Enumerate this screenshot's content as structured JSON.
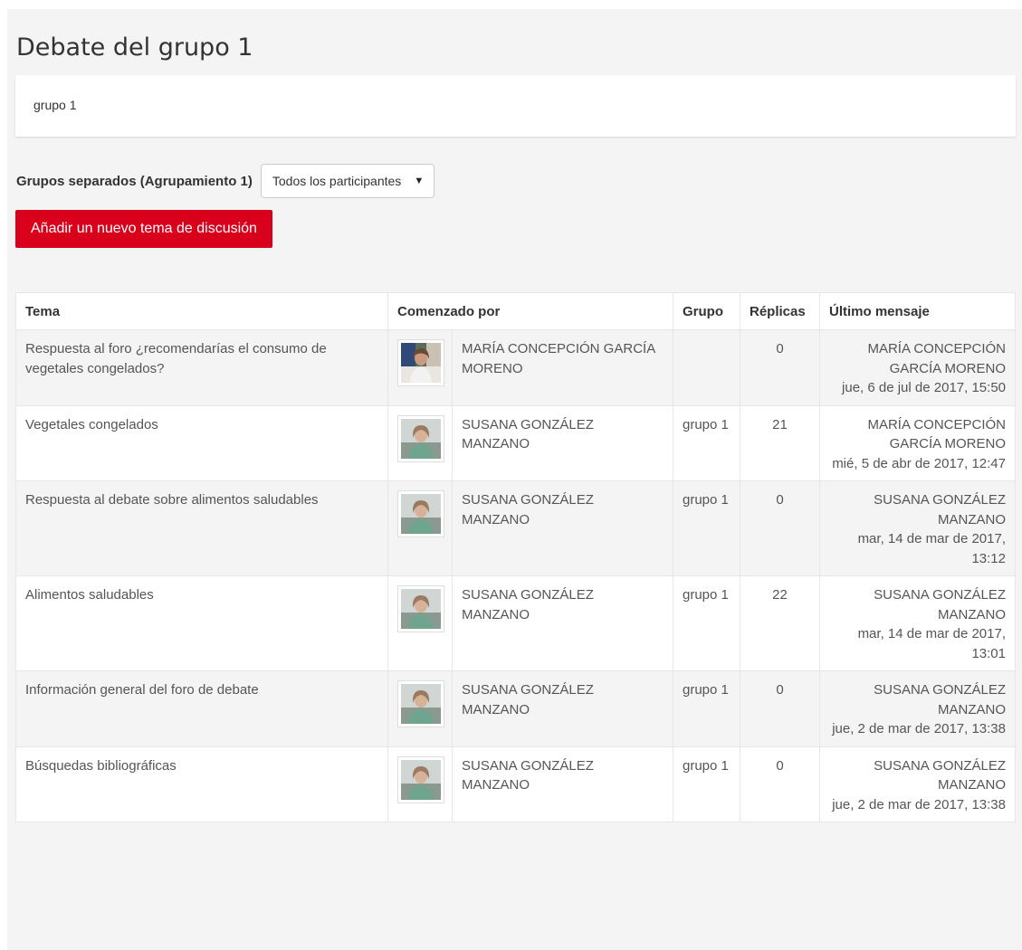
{
  "page_title": "Debate del grupo 1",
  "intro_text": "grupo 1",
  "groups": {
    "label": "Grupos separados (Agrupamiento 1)",
    "selected": "Todos los participantes"
  },
  "add_button_label": "Añadir un nuevo tema de discusión",
  "table": {
    "headers": [
      "Tema",
      "Comenzado por",
      "Grupo",
      "Réplicas",
      "Último mensaje"
    ],
    "rows": [
      {
        "topic": "Respuesta al foro ¿recomendarías el consumo de vegetales congelados?",
        "avatar": "woman-photo-indoor",
        "started_by": "MARÍA CONCEPCIÓN GARCÍA MORENO",
        "group": "",
        "replies": "0",
        "last_user": "MARÍA CONCEPCIÓN GARCÍA MORENO",
        "last_date": "jue, 6 de jul de 2017, 15:50"
      },
      {
        "topic": "Vegetales congelados",
        "avatar": "woman-photo-outdoor",
        "started_by": "SUSANA GONZÁLEZ MANZANO",
        "group": "grupo 1",
        "replies": "21",
        "last_user": "MARÍA CONCEPCIÓN GARCÍA MORENO",
        "last_date": "mié, 5 de abr de 2017, 12:47"
      },
      {
        "topic": "Respuesta al debate sobre alimentos saludables",
        "avatar": "woman-photo-outdoor",
        "started_by": "SUSANA GONZÁLEZ MANZANO",
        "group": "grupo 1",
        "replies": "0",
        "last_user": "SUSANA GONZÁLEZ MANZANO",
        "last_date": "mar, 14 de mar de 2017, 13:12"
      },
      {
        "topic": "Alimentos saludables",
        "avatar": "woman-photo-outdoor",
        "started_by": "SUSANA GONZÁLEZ MANZANO",
        "group": "grupo 1",
        "replies": "22",
        "last_user": "SUSANA GONZÁLEZ MANZANO",
        "last_date": "mar, 14 de mar de 2017, 13:01"
      },
      {
        "topic": "Información general del foro de debate",
        "avatar": "woman-photo-outdoor",
        "started_by": "SUSANA GONZÁLEZ MANZANO",
        "group": "grupo 1",
        "replies": "0",
        "last_user": "SUSANA GONZÁLEZ MANZANO",
        "last_date": "jue, 2 de mar de 2017, 13:38"
      },
      {
        "topic": "Búsquedas bibliográficas",
        "avatar": "woman-photo-outdoor",
        "started_by": "SUSANA GONZÁLEZ MANZANO",
        "group": "grupo 1",
        "replies": "0",
        "last_user": "SUSANA GONZÁLEZ MANZANO",
        "last_date": "jue, 2 de mar de 2017, 13:38"
      }
    ]
  },
  "colors": {
    "accent": "#d9001b",
    "page_bg": "#f4f4f4",
    "text": "#555555"
  }
}
